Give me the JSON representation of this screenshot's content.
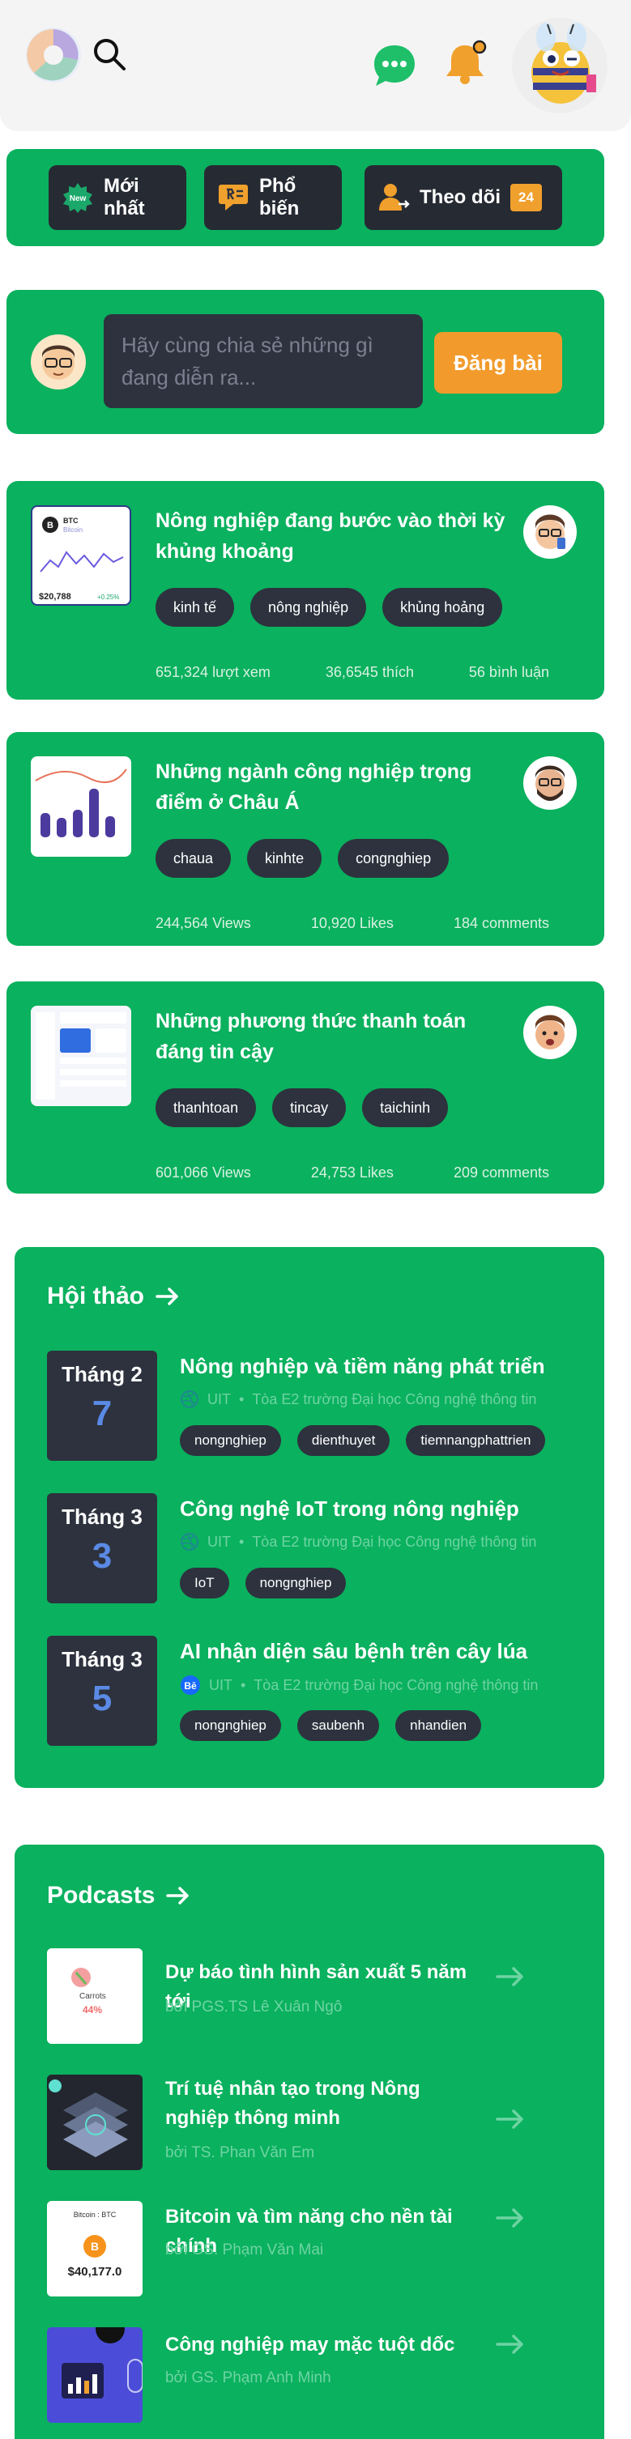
{
  "filters": [
    {
      "label": "Mới nhất",
      "icon": "new-badge-icon"
    },
    {
      "label": "Phổ biến",
      "icon": "popular-icon"
    },
    {
      "label": "Theo dõi",
      "icon": "follow-icon",
      "count": "24"
    }
  ],
  "composer": {
    "placeholder": "Hãy cùng chia sẻ những gì đang diễn ra...",
    "post_label": "Đăng bài"
  },
  "posts": [
    {
      "title": "Nông nghiệp đang bước vào thời kỳ khủng khoảng",
      "tags": [
        "kinh tế",
        "nông nghiệp",
        "khủng hoảng"
      ],
      "views": "651,324 lượt xem",
      "likes": "36,6545 thích",
      "comments": "56 bình luận",
      "thumb": {
        "symbol": "BTC",
        "name": "Bitcoin",
        "price": "$20,788",
        "change": "+0.25%"
      }
    },
    {
      "title": "Những ngành công nghiệp trọng điểm ở Châu Á",
      "tags": [
        "chaua",
        "kinhte",
        "congnghiep"
      ],
      "views": "244,564 Views",
      "likes": "10,920 Likes",
      "comments": "184 comments"
    },
    {
      "title": "Những phương thức thanh toán đáng tin cậy",
      "tags": [
        "thanhtoan",
        "tincay",
        "taichinh"
      ],
      "views": "601,066 Views",
      "likes": "24,753 Likes",
      "comments": "209 comments"
    }
  ],
  "workshops": {
    "title": "Hội thảo",
    "items": [
      {
        "month": "Tháng 2",
        "day": "7",
        "title": "Nông nghiệp và tiềm năng phát triển",
        "org": "UIT",
        "location": "Tòa E2 trường Đại học Công nghệ thông tin",
        "tags": [
          "nongnghiep",
          "dienthuyet",
          "tiemnangphattrien"
        ]
      },
      {
        "month": "Tháng 3",
        "day": "3",
        "title": "Công nghệ IoT trong nông nghiệp",
        "org": "UIT",
        "location": "Tòa E2 trường Đại học Công nghệ thông tin",
        "tags": [
          "IoT",
          "nongnghiep"
        ]
      },
      {
        "month": "Tháng 3",
        "day": "5",
        "title": "AI nhận diện sâu bệnh trên cây lúa",
        "org": "UIT",
        "location": "Tòa E2 trường Đại học Công nghệ thông tin",
        "tags": [
          "nongnghiep",
          "saubenh",
          "nhandien"
        ]
      }
    ]
  },
  "podcasts": {
    "title": "Podcasts",
    "items": [
      {
        "title": "Dự báo tình hình sản xuất 5 năm tới",
        "author": "bởi PGS.TS Lê Xuân Ngô",
        "thumb_text": "Carrots",
        "thumb_value": "44%"
      },
      {
        "title": "Trí tuệ nhân tạo trong Nông nghiệp thông minh",
        "author": "bởi TS. Phan Văn Em"
      },
      {
        "title": "Bitcoin và tìm năng cho nền tài chính",
        "author": "bởi GS. Phạm Văn Mai",
        "thumb_text": "Bitcoin : BTC",
        "thumb_value": "$40,177.0"
      },
      {
        "title": "Công nghiệp may mặc tuột dốc",
        "author": "bởi GS. Phạm Anh Minh"
      }
    ]
  },
  "colors": {
    "primary_green": "#0ab15e",
    "dark": "#2d323e",
    "accent_orange": "#f29b2c",
    "date_blue": "#5a8ae6"
  }
}
